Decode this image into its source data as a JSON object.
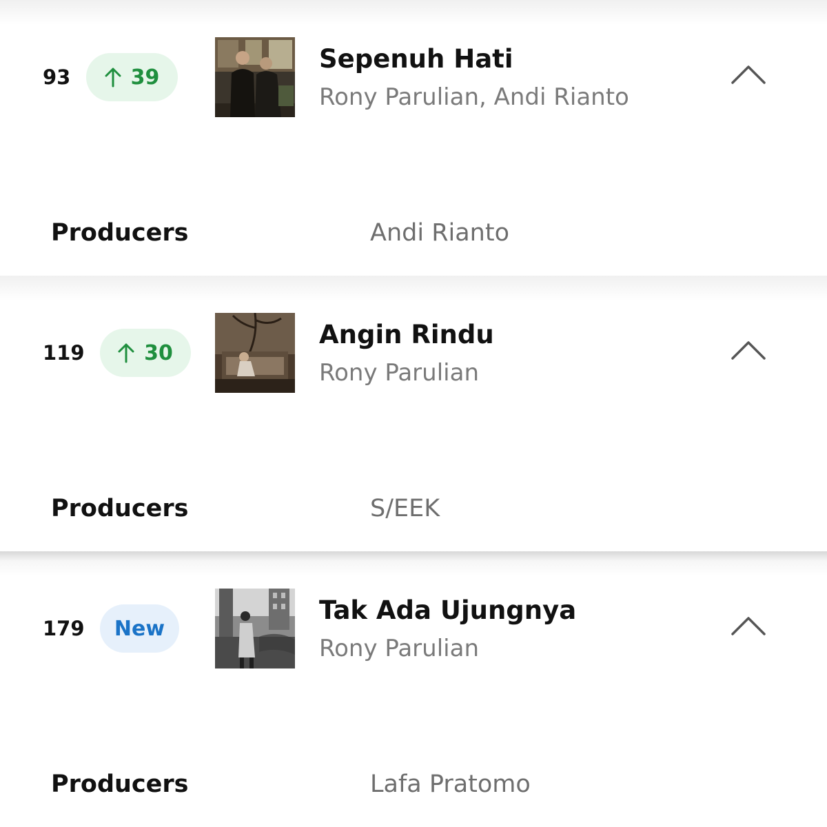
{
  "tracks": [
    {
      "rank": "93",
      "change": {
        "type": "up",
        "value": "39",
        "icon": "arrow-up-icon",
        "color": "#1f8f3e",
        "bg": "#e6f6ea"
      },
      "cover": "two-men-in-dark-suits-photo",
      "title": "Sepenuh Hati",
      "artist": "Rony Parulian, Andi Rianto",
      "expand_icon": "chevron-up-icon",
      "credits": [
        {
          "label": "Producers",
          "value": "Andi Rianto"
        }
      ]
    },
    {
      "rank": "119",
      "change": {
        "type": "up",
        "value": "30",
        "icon": "arrow-up-icon",
        "color": "#1f8f3e",
        "bg": "#e6f6ea"
      },
      "cover": "man-seated-in-dim-room-photo",
      "title": "Angin Rindu",
      "artist": "Rony Parulian",
      "expand_icon": "chevron-up-icon",
      "credits": [
        {
          "label": "Producers",
          "value": "S/EEK"
        }
      ]
    },
    {
      "rank": "179",
      "change": {
        "type": "new",
        "value": "New",
        "color": "#1a73c7",
        "bg": "#e6f0fb"
      },
      "cover": "black-and-white-street-photo",
      "title": "Tak Ada Ujungnya",
      "artist": "Rony Parulian",
      "expand_icon": "chevron-up-icon",
      "credits": [
        {
          "label": "Producers",
          "value": "Lafa Pratomo"
        }
      ]
    }
  ]
}
